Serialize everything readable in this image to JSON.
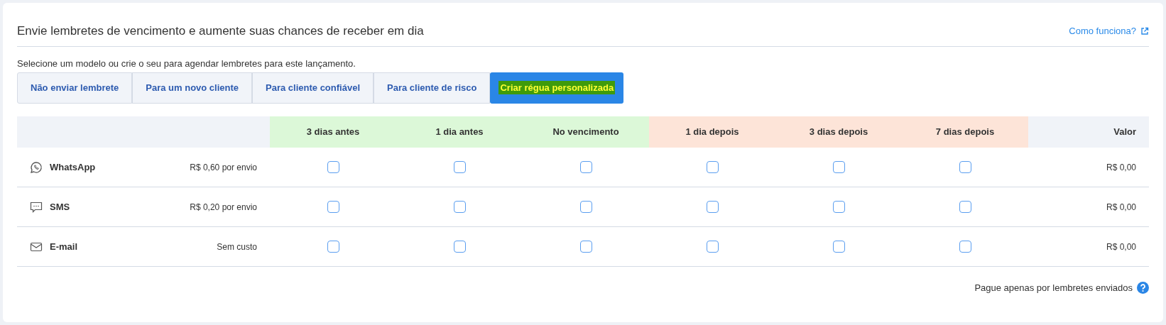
{
  "title": "Envie lembretes de vencimento e aumente suas chances de receber em dia",
  "help_link": "Como funciona?",
  "instruction": "Selecione um modelo ou crie o seu para agendar lembretes para este lançamento.",
  "tabs": [
    {
      "label": "Não enviar lembrete",
      "selected": false
    },
    {
      "label": "Para um novo cliente",
      "selected": false
    },
    {
      "label": "Para cliente confiável",
      "selected": false
    },
    {
      "label": "Para cliente de risco",
      "selected": false
    },
    {
      "label": "Criar régua personalizada",
      "selected": true
    }
  ],
  "table": {
    "columns": [
      {
        "label": "3 dias antes",
        "color": "#dcf8d8"
      },
      {
        "label": "1 dia antes",
        "color": "#dcf8d8"
      },
      {
        "label": "No vencimento",
        "color": "#dcf8d8"
      },
      {
        "label": "1 dia depois",
        "color": "#fde4d8"
      },
      {
        "label": "3 dias depois",
        "color": "#fde4d8"
      },
      {
        "label": "7 dias depois",
        "color": "#fde4d8"
      }
    ],
    "value_column": "Valor",
    "rows": [
      {
        "kind": "whatsapp",
        "channel": "WhatsApp",
        "cost": "R$ 0,60 por envio",
        "checks": [
          false,
          false,
          false,
          false,
          false,
          false
        ],
        "value": "R$ 0,00"
      },
      {
        "kind": "sms",
        "channel": "SMS",
        "cost": "R$ 0,20 por envio",
        "checks": [
          false,
          false,
          false,
          false,
          false,
          false
        ],
        "value": "R$ 0,00"
      },
      {
        "kind": "email",
        "channel": "E-mail",
        "cost": "Sem custo",
        "checks": [
          false,
          false,
          false,
          false,
          false,
          false
        ],
        "value": "R$ 0,00"
      }
    ]
  },
  "footer": "Pague apenas por lembretes enviados"
}
